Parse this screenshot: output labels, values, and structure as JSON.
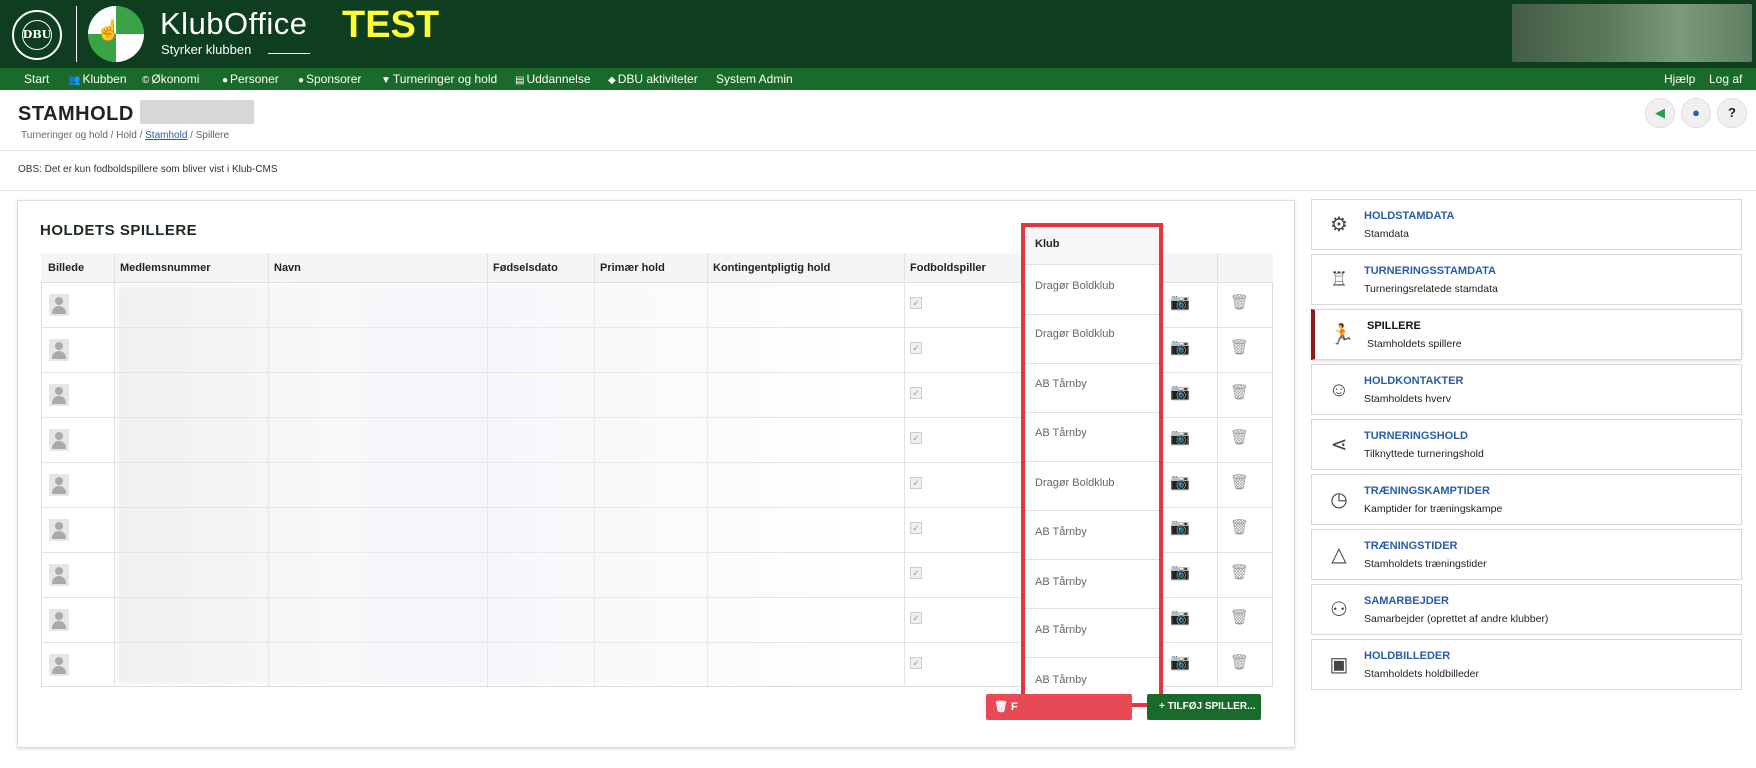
{
  "header": {
    "dbu_logo_text": "DBU",
    "brand_name": "KlubOffice",
    "brand_tagline": "Styrker klubben",
    "env_label": "TEST"
  },
  "nav": {
    "left": [
      {
        "label": "Start",
        "icon": ""
      },
      {
        "label": "Klubben",
        "icon": "people-icon"
      },
      {
        "label": "Økonomi",
        "icon": "coin-icon"
      },
      {
        "label": "Personer",
        "icon": "person-icon"
      },
      {
        "label": "Sponsorer",
        "icon": "moneybag-icon"
      },
      {
        "label": "Turneringer og hold",
        "icon": "shield-icon"
      },
      {
        "label": "Uddannelse",
        "icon": "board-icon"
      },
      {
        "label": "DBU aktiviteter",
        "icon": "graduation-icon"
      },
      {
        "label": "System Admin",
        "icon": ""
      }
    ],
    "right": [
      {
        "label": "Hjælp"
      },
      {
        "label": "Log af"
      }
    ]
  },
  "page": {
    "title": "STAMHOLD -",
    "breadcrumb": {
      "part1": "Turneringer og hold / Hold / ",
      "link": "Stamhold",
      "part2": " / Spillere"
    },
    "notice": "OBS: Det er kun fodboldspillere som bliver vist i Klub-CMS",
    "round_buttons": [
      "back-icon",
      "info-icon",
      "help-icon"
    ],
    "help_symbol": "?"
  },
  "players_section": {
    "heading": "HOLDETS SPILLERE",
    "columns": [
      "Billede",
      "Medlemsnummer",
      "Navn",
      "Fødselsdato",
      "Primær hold",
      "Kontingentpligtig hold",
      "Fodboldspiller"
    ],
    "klub_header": "Klub",
    "klub_values": [
      "Dragør Boldklub",
      "Dragør Boldklub",
      "AB Tårnby",
      "AB Tårnby",
      "Dragør Boldklub",
      "AB Tårnby",
      "AB Tårnby",
      "AB Tårnby",
      "AB Tårnby"
    ],
    "row_count": 9,
    "remove_button": "F",
    "add_button": "TILFØJ SPILLER..."
  },
  "side_menu": [
    {
      "title": "HOLDSTAMDATA",
      "sub": "Stamdata",
      "icon": "gear-icon"
    },
    {
      "title": "TURNERINGSSTAMDATA",
      "sub": "Turneringsrelatede stamdata",
      "icon": "trophy-icon"
    },
    {
      "title": "SPILLERE",
      "sub": "Stamholdets spillere",
      "icon": "footballer-icon",
      "active": true
    },
    {
      "title": "HOLDKONTAKTER",
      "sub": "Stamholdets hverv",
      "icon": "contact-icon"
    },
    {
      "title": "TURNERINGSHOLD",
      "sub": "Tilknyttede turneringshold",
      "icon": "share-icon"
    },
    {
      "title": "TRÆNINGSKAMPTIDER",
      "sub": "Kamptider for træningskampe",
      "icon": "clock-icon"
    },
    {
      "title": "TRÆNINGSTIDER",
      "sub": "Stamholdets træningstider",
      "icon": "training-cone-icon"
    },
    {
      "title": "SAMARBEJDER",
      "sub": "Samarbejder (oprettet af andre klubber)",
      "icon": "network-icon"
    },
    {
      "title": "HOLDBILLEDER",
      "sub": "Stamholdets holdbilleder",
      "icon": "picture-icon"
    }
  ]
}
